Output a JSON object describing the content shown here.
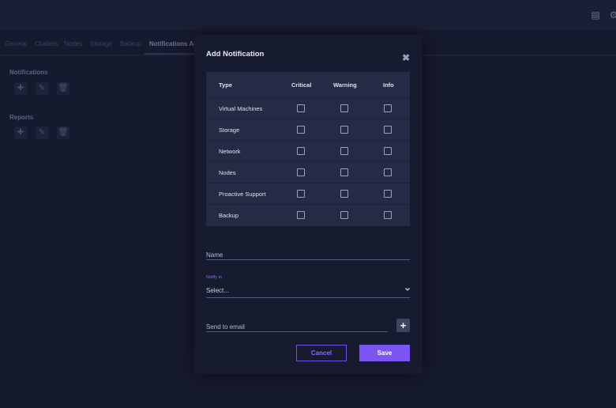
{
  "topbar": {
    "icons": [
      "list-icon",
      "gear-icon"
    ]
  },
  "background": {
    "tabs": [
      "General",
      "Clusters",
      "Nodes",
      "Storage",
      "Backup",
      "Notifications An"
    ],
    "sections": {
      "notifications": "Notifications",
      "reports": "Reports"
    },
    "section_buttons": [
      "add-icon",
      "edit-icon",
      "delete-icon"
    ]
  },
  "modal": {
    "title": "Add Notification",
    "table": {
      "headers": [
        "Type",
        "Critical",
        "Warning",
        "Info"
      ],
      "rows": [
        {
          "type": "Virtual Machines",
          "critical": false,
          "warning": false,
          "info": false
        },
        {
          "type": "Storage",
          "critical": false,
          "warning": false,
          "info": false
        },
        {
          "type": "Network",
          "critical": false,
          "warning": false,
          "info": false
        },
        {
          "type": "Nodes",
          "critical": false,
          "warning": false,
          "info": false
        },
        {
          "type": "Proactive Support",
          "critical": false,
          "warning": false,
          "info": false
        },
        {
          "type": "Backup",
          "critical": false,
          "warning": false,
          "info": false
        }
      ]
    },
    "name_placeholder": "Name",
    "notify_label": "Notify in",
    "notify_value": "Select...",
    "email_placeholder": "Send to email",
    "add_label": "+",
    "cancel_label": "Cancel",
    "save_label": "Save"
  },
  "colors": {
    "background": "#161a2e",
    "modal": "#171b30",
    "table": "#252b45",
    "accent": "#7a55f2"
  }
}
